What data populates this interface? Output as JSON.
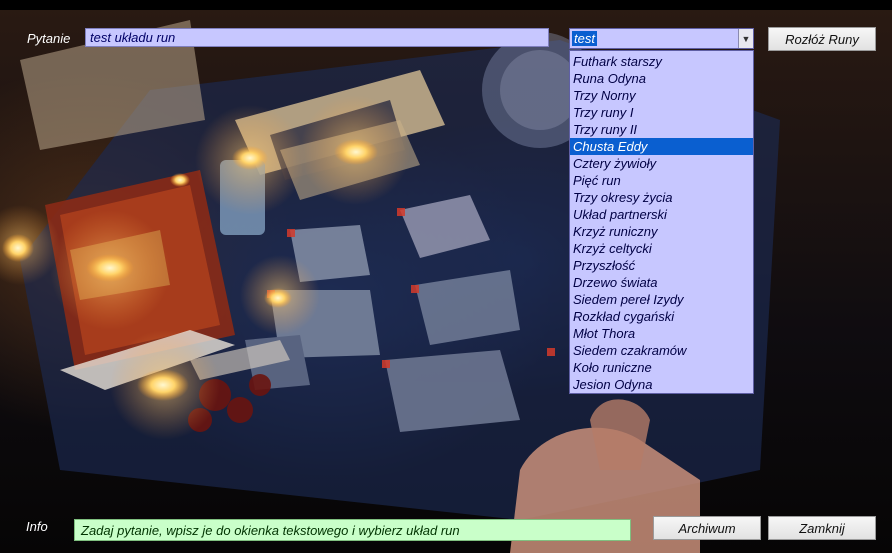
{
  "question": {
    "label": "Pytanie",
    "value": "test układu run"
  },
  "spread_select": {
    "value": "test",
    "options": [
      "Futhark starszy",
      "Runa Odyna",
      "Trzy Norny",
      "Trzy runy I",
      "Trzy runy II",
      "Chusta Eddy",
      "Cztery żywioły",
      "Pięć run",
      "Trzy okresy życia",
      "Układ partnerski",
      "Krzyż runiczny",
      "Krzyż celtycki",
      "Przyszłość",
      "Drzewo świata",
      "Siedem pereł Izydy",
      "Rozkład cygański",
      "Młot Thora",
      "Siedem czakramów",
      "Koło runiczne",
      "Jesion Odyna"
    ],
    "highlighted_index": 5
  },
  "buttons": {
    "spread": "Rozłóż Runy",
    "archive": "Archiwum",
    "close": "Zamknij"
  },
  "info": {
    "label": "Info",
    "text": "Zadaj pytanie, wpisz je do okienka tekstowego i wybierz układ run"
  },
  "colors": {
    "input_bg": "#c7c7ff",
    "info_bg": "#c9ffc9",
    "highlight": "#0a5fd0"
  }
}
